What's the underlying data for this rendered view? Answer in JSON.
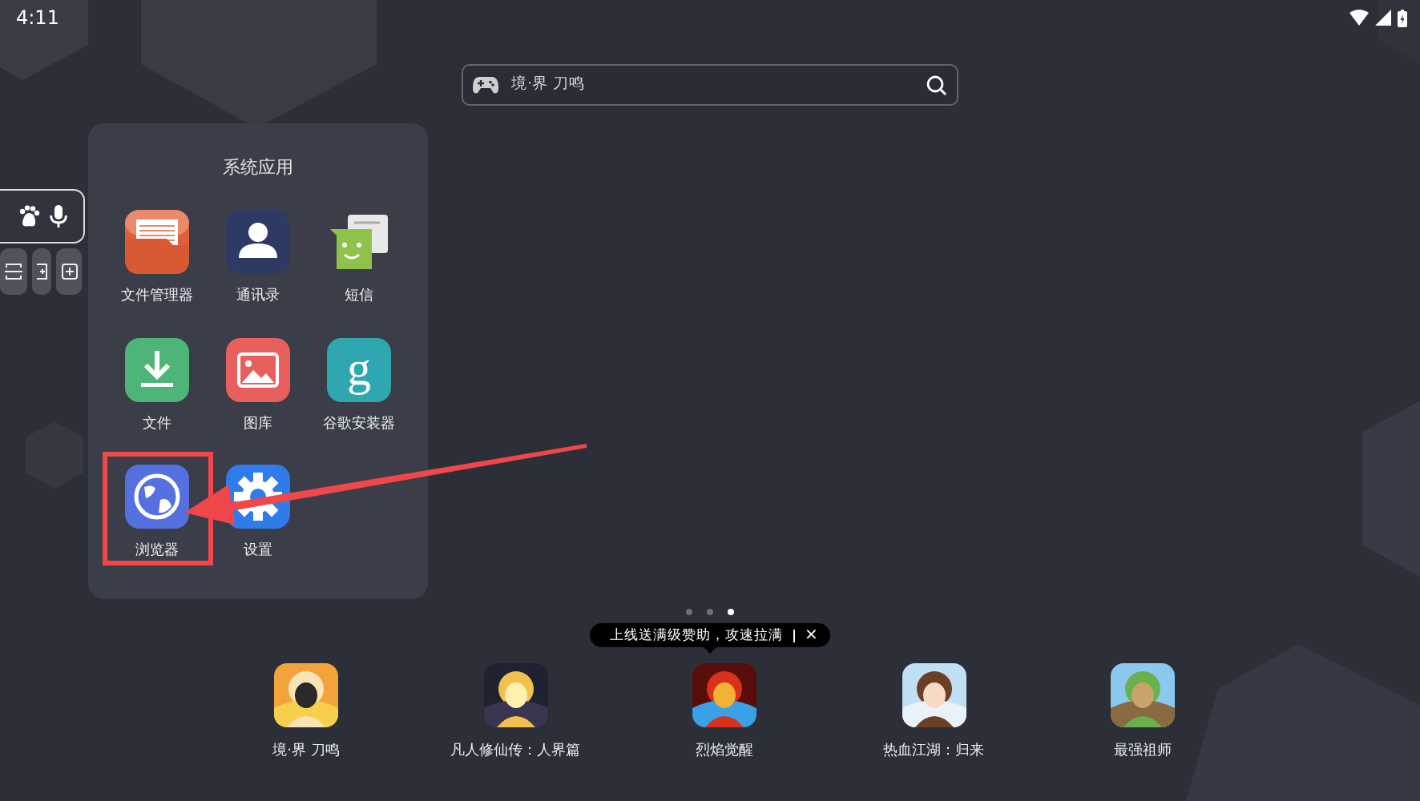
{
  "status_bar": {
    "time": "4:11"
  },
  "search": {
    "placeholder": "境·界 刀鸣"
  },
  "folder": {
    "title": "系统应用",
    "apps": [
      {
        "label": "文件管理器",
        "kind": "files",
        "highlighted": false
      },
      {
        "label": "通讯录",
        "kind": "contacts",
        "highlighted": false
      },
      {
        "label": "短信",
        "kind": "messages",
        "highlighted": false
      },
      {
        "label": "文件",
        "kind": "download",
        "highlighted": false
      },
      {
        "label": "图库",
        "kind": "gallery",
        "highlighted": false
      },
      {
        "label": "谷歌安装器",
        "kind": "letter",
        "glyph": "g",
        "highlighted": false
      },
      {
        "label": "浏览器",
        "kind": "browser",
        "highlighted": true
      },
      {
        "label": "设置",
        "kind": "settings",
        "highlighted": false
      }
    ]
  },
  "pages": [
    {
      "selected": false
    },
    {
      "selected": false
    },
    {
      "selected": true
    }
  ],
  "tooltip": {
    "text": "上线送满级赞助，攻速拉满",
    "close": "×"
  },
  "dock": [
    {
      "label": "境·界 刀鸣",
      "kind": "picture"
    },
    {
      "label": "凡人修仙传：人界篇",
      "kind": "picture"
    },
    {
      "label": "烈焰觉醒",
      "kind": "picture"
    },
    {
      "label": "热血江湖：归来",
      "kind": "picture"
    },
    {
      "label": "最强祖师",
      "kind": "picture"
    }
  ]
}
